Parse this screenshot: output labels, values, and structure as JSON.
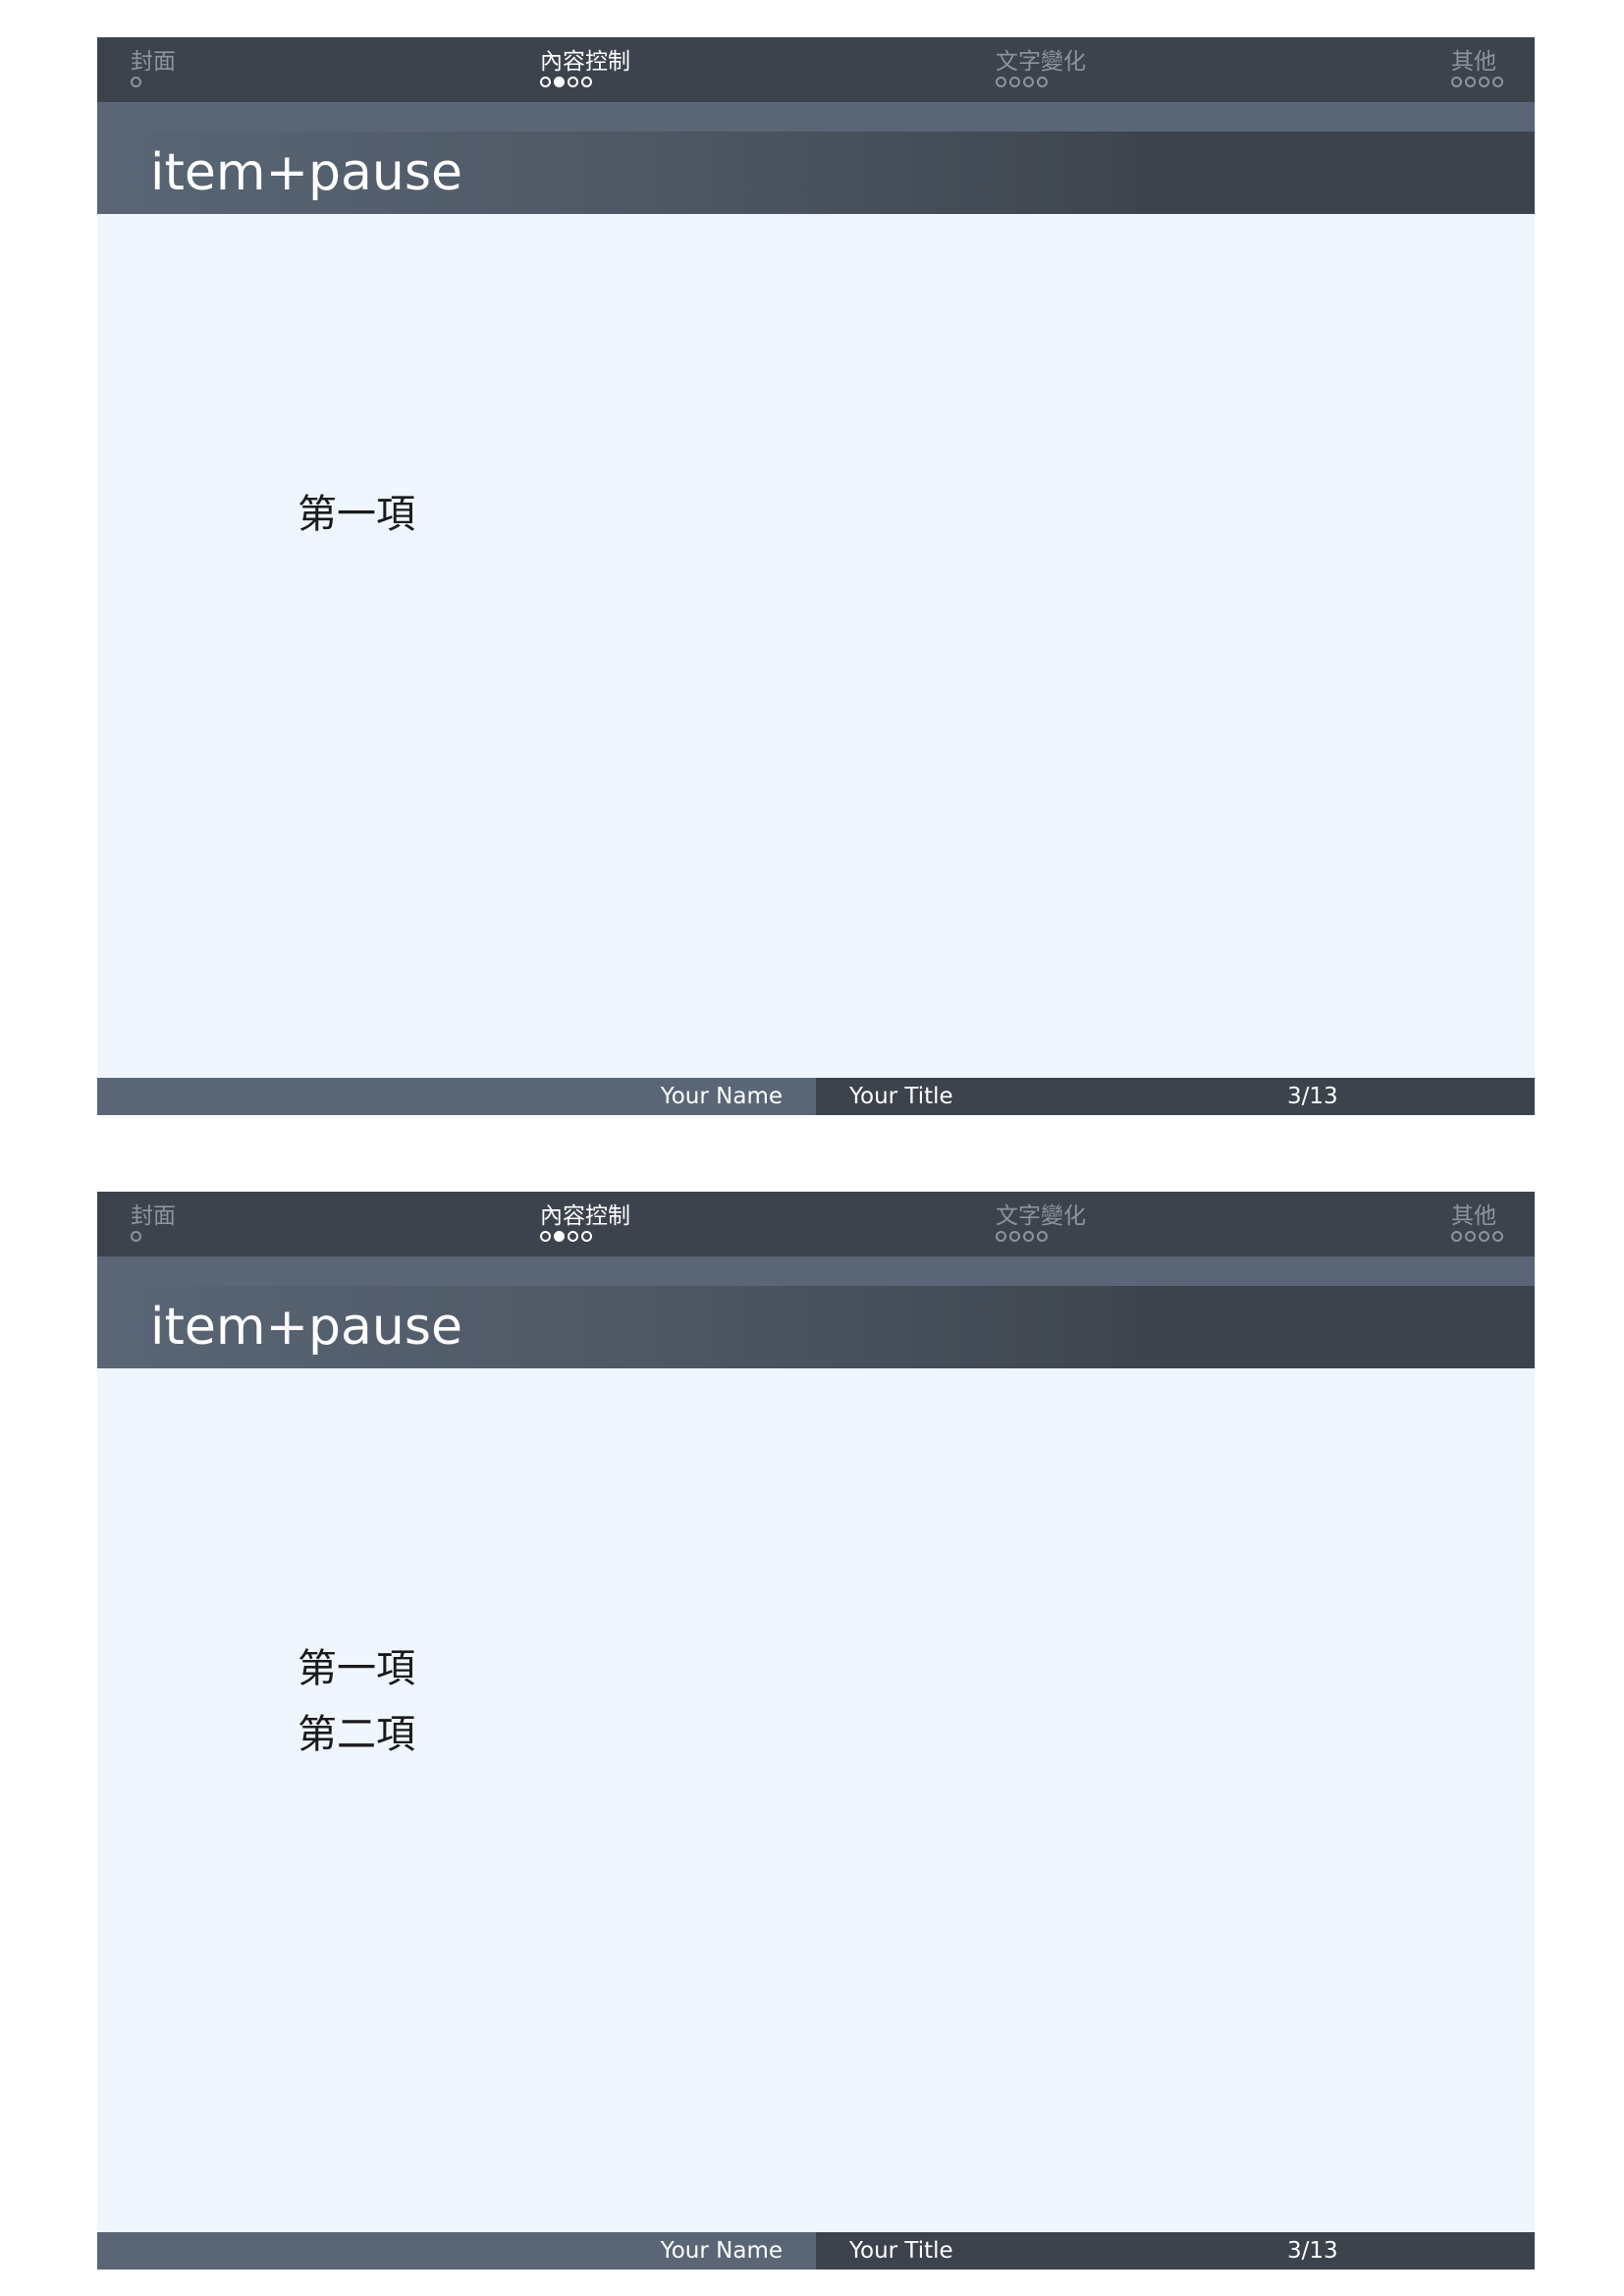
{
  "nav": {
    "sections": [
      {
        "label": "封面",
        "dots": 1,
        "current_dot": null
      },
      {
        "label": "內容控制",
        "dots": 4,
        "current_dot": 2
      },
      {
        "label": "文字變化",
        "dots": 4,
        "current_dot": null
      },
      {
        "label": "其他",
        "dots": 4,
        "current_dot": null
      }
    ],
    "active_section": 2
  },
  "slides": [
    {
      "title": "item+pause",
      "items": [
        "第一項"
      ]
    },
    {
      "title": "item+pause",
      "items": [
        "第一項",
        "第二項"
      ]
    }
  ],
  "footer": {
    "author": "Your Name",
    "title": "Your Title",
    "page": "3/13"
  },
  "colors": {
    "headline_bg": "#3c434c",
    "subbar_bg": "#5a6675",
    "slide_bg": "#eff6fd",
    "inactive_text": "#8c949e"
  }
}
